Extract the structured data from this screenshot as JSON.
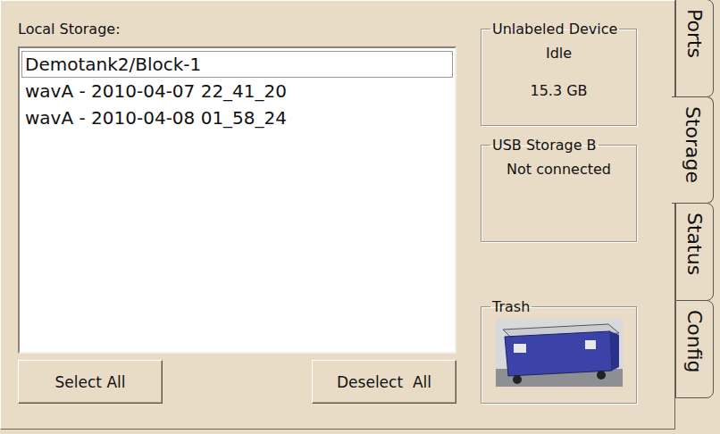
{
  "tabs": [
    {
      "label": "Ports",
      "selected": false
    },
    {
      "label": "Storage",
      "selected": true
    },
    {
      "label": "Status",
      "selected": false
    },
    {
      "label": "Config",
      "selected": false
    }
  ],
  "local_storage": {
    "label": "Local Storage:",
    "items": [
      {
        "name": "Demotank2/Block-1",
        "selected": false,
        "focused": true
      },
      {
        "name": "wavA - 2010-04-07 22_41_20",
        "selected": false,
        "focused": false
      },
      {
        "name": "wavA - 2010-04-08 01_58_24",
        "selected": false,
        "focused": false
      }
    ]
  },
  "buttons": [
    "Select All",
    "Deselect  All"
  ],
  "devices": [
    {
      "title": "Unlabeled Device",
      "lines": [
        "Idle",
        "15.3 GB"
      ]
    },
    {
      "title": "USB Storage B",
      "lines": [
        "Not connected"
      ]
    }
  ],
  "trash": {
    "title": "Trash"
  }
}
